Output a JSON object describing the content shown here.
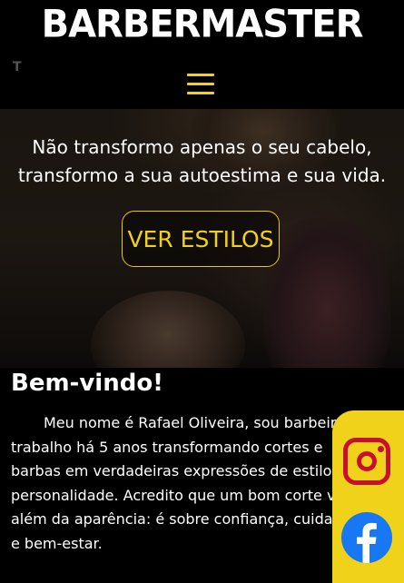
{
  "header": {
    "logo": "BARBERMASTER",
    "menu_icon": "hamburger-menu-icon",
    "accent_color": "#f1d21a"
  },
  "hero": {
    "tagline": "Não transformo apenas o seu cabelo, transformo a sua autoestima e sua vida.",
    "cta_label": "VER ESTILOS"
  },
  "welcome": {
    "title": "Bem-vindo!",
    "body": "Meu nome é Rafael Oliveira, sou barbeiro e trabalho há 5 anos transformando cortes e barbas em verdadeiras expressões de estilo e personalidade. Acredito que um bom corte vai além da aparência: é sobre confiança, cuidado e bem-estar."
  },
  "social": {
    "instagram_icon": "instagram-icon",
    "facebook_icon": "facebook-icon",
    "instagram_color": "#c8102e",
    "facebook_color": "#1877f2",
    "panel_color": "#f1d21a"
  }
}
